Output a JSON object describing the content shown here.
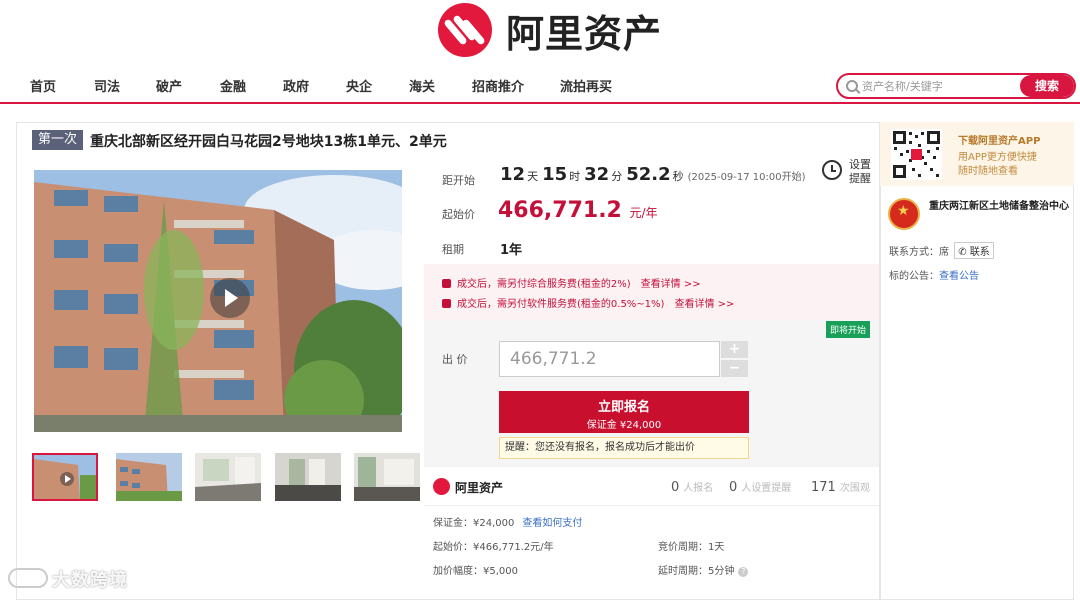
{
  "header": {
    "logo_text": "阿里资产"
  },
  "nav": {
    "items": [
      "首页",
      "司法",
      "破产",
      "金融",
      "政府",
      "央企",
      "海关",
      "招商推介",
      "流拍再买"
    ]
  },
  "search": {
    "placeholder": "资产名称/关键字",
    "button": "搜索"
  },
  "listing": {
    "round_badge": "第一次",
    "title": "重庆北部新区经开园白马花园2号地块13栋1单元、2单元"
  },
  "countdown": {
    "label": "距开始",
    "days": "12",
    "days_unit": "天",
    "hours": "15",
    "hours_unit": "时",
    "minutes": "32",
    "minutes_unit": "分",
    "seconds": "52.2",
    "seconds_unit": "秒",
    "start_time": "(2025-09-17 10:00开始)"
  },
  "alarm": {
    "label": "设置提醒"
  },
  "price": {
    "label": "起始价",
    "value": "466,771.2",
    "unit": "元/年"
  },
  "lease": {
    "label": "租期",
    "value": "1年"
  },
  "fees": [
    {
      "text": "成交后，需另付综合服务费(租金的2%)",
      "link": "查看详情 >>"
    },
    {
      "text": "成交后，需另付软件服务费(租金的0.5%~1%)",
      "link": "查看详情 >>"
    }
  ],
  "bid": {
    "status_badge": "即将开始",
    "label": "出 价",
    "value": "466,771.2",
    "plus": "+",
    "minus": "−",
    "signup_label": "立即报名",
    "deposit_label": "保证金 ¥24,000",
    "tip": "提醒：您还没有报名，报名成功后才能出价"
  },
  "stats": {
    "brand": "阿里资产",
    "signups": "0",
    "signups_label": "人报名",
    "reminders": "0",
    "reminders_label": "人设置提醒",
    "views": "171",
    "views_label": "次围观"
  },
  "details": {
    "deposit": "保证金：¥24,000",
    "pay_link": "查看如何支付",
    "start_price": "起始价：¥466,771.2元/年",
    "increment": "加价幅度：¥5,000",
    "bid_period": "竞价周期：1天",
    "extension": "延时周期：5分钟"
  },
  "side": {
    "app_title": "下载阿里资产APP",
    "app_sub_1": "用APP更方便快捷",
    "app_sub_2": "随时随地查看",
    "org_name": "重庆两江新区土地储备整治中心",
    "contact_label": "联系方式：席",
    "contact_button": "联系",
    "notice_label": "标的公告：",
    "notice_link": "查看公告"
  },
  "watermark": "大数跨境",
  "colors": {
    "brand_red": "#d9163f",
    "price_red": "#c40f38",
    "link_blue": "#3a6ec8",
    "status_green": "#18a058"
  }
}
